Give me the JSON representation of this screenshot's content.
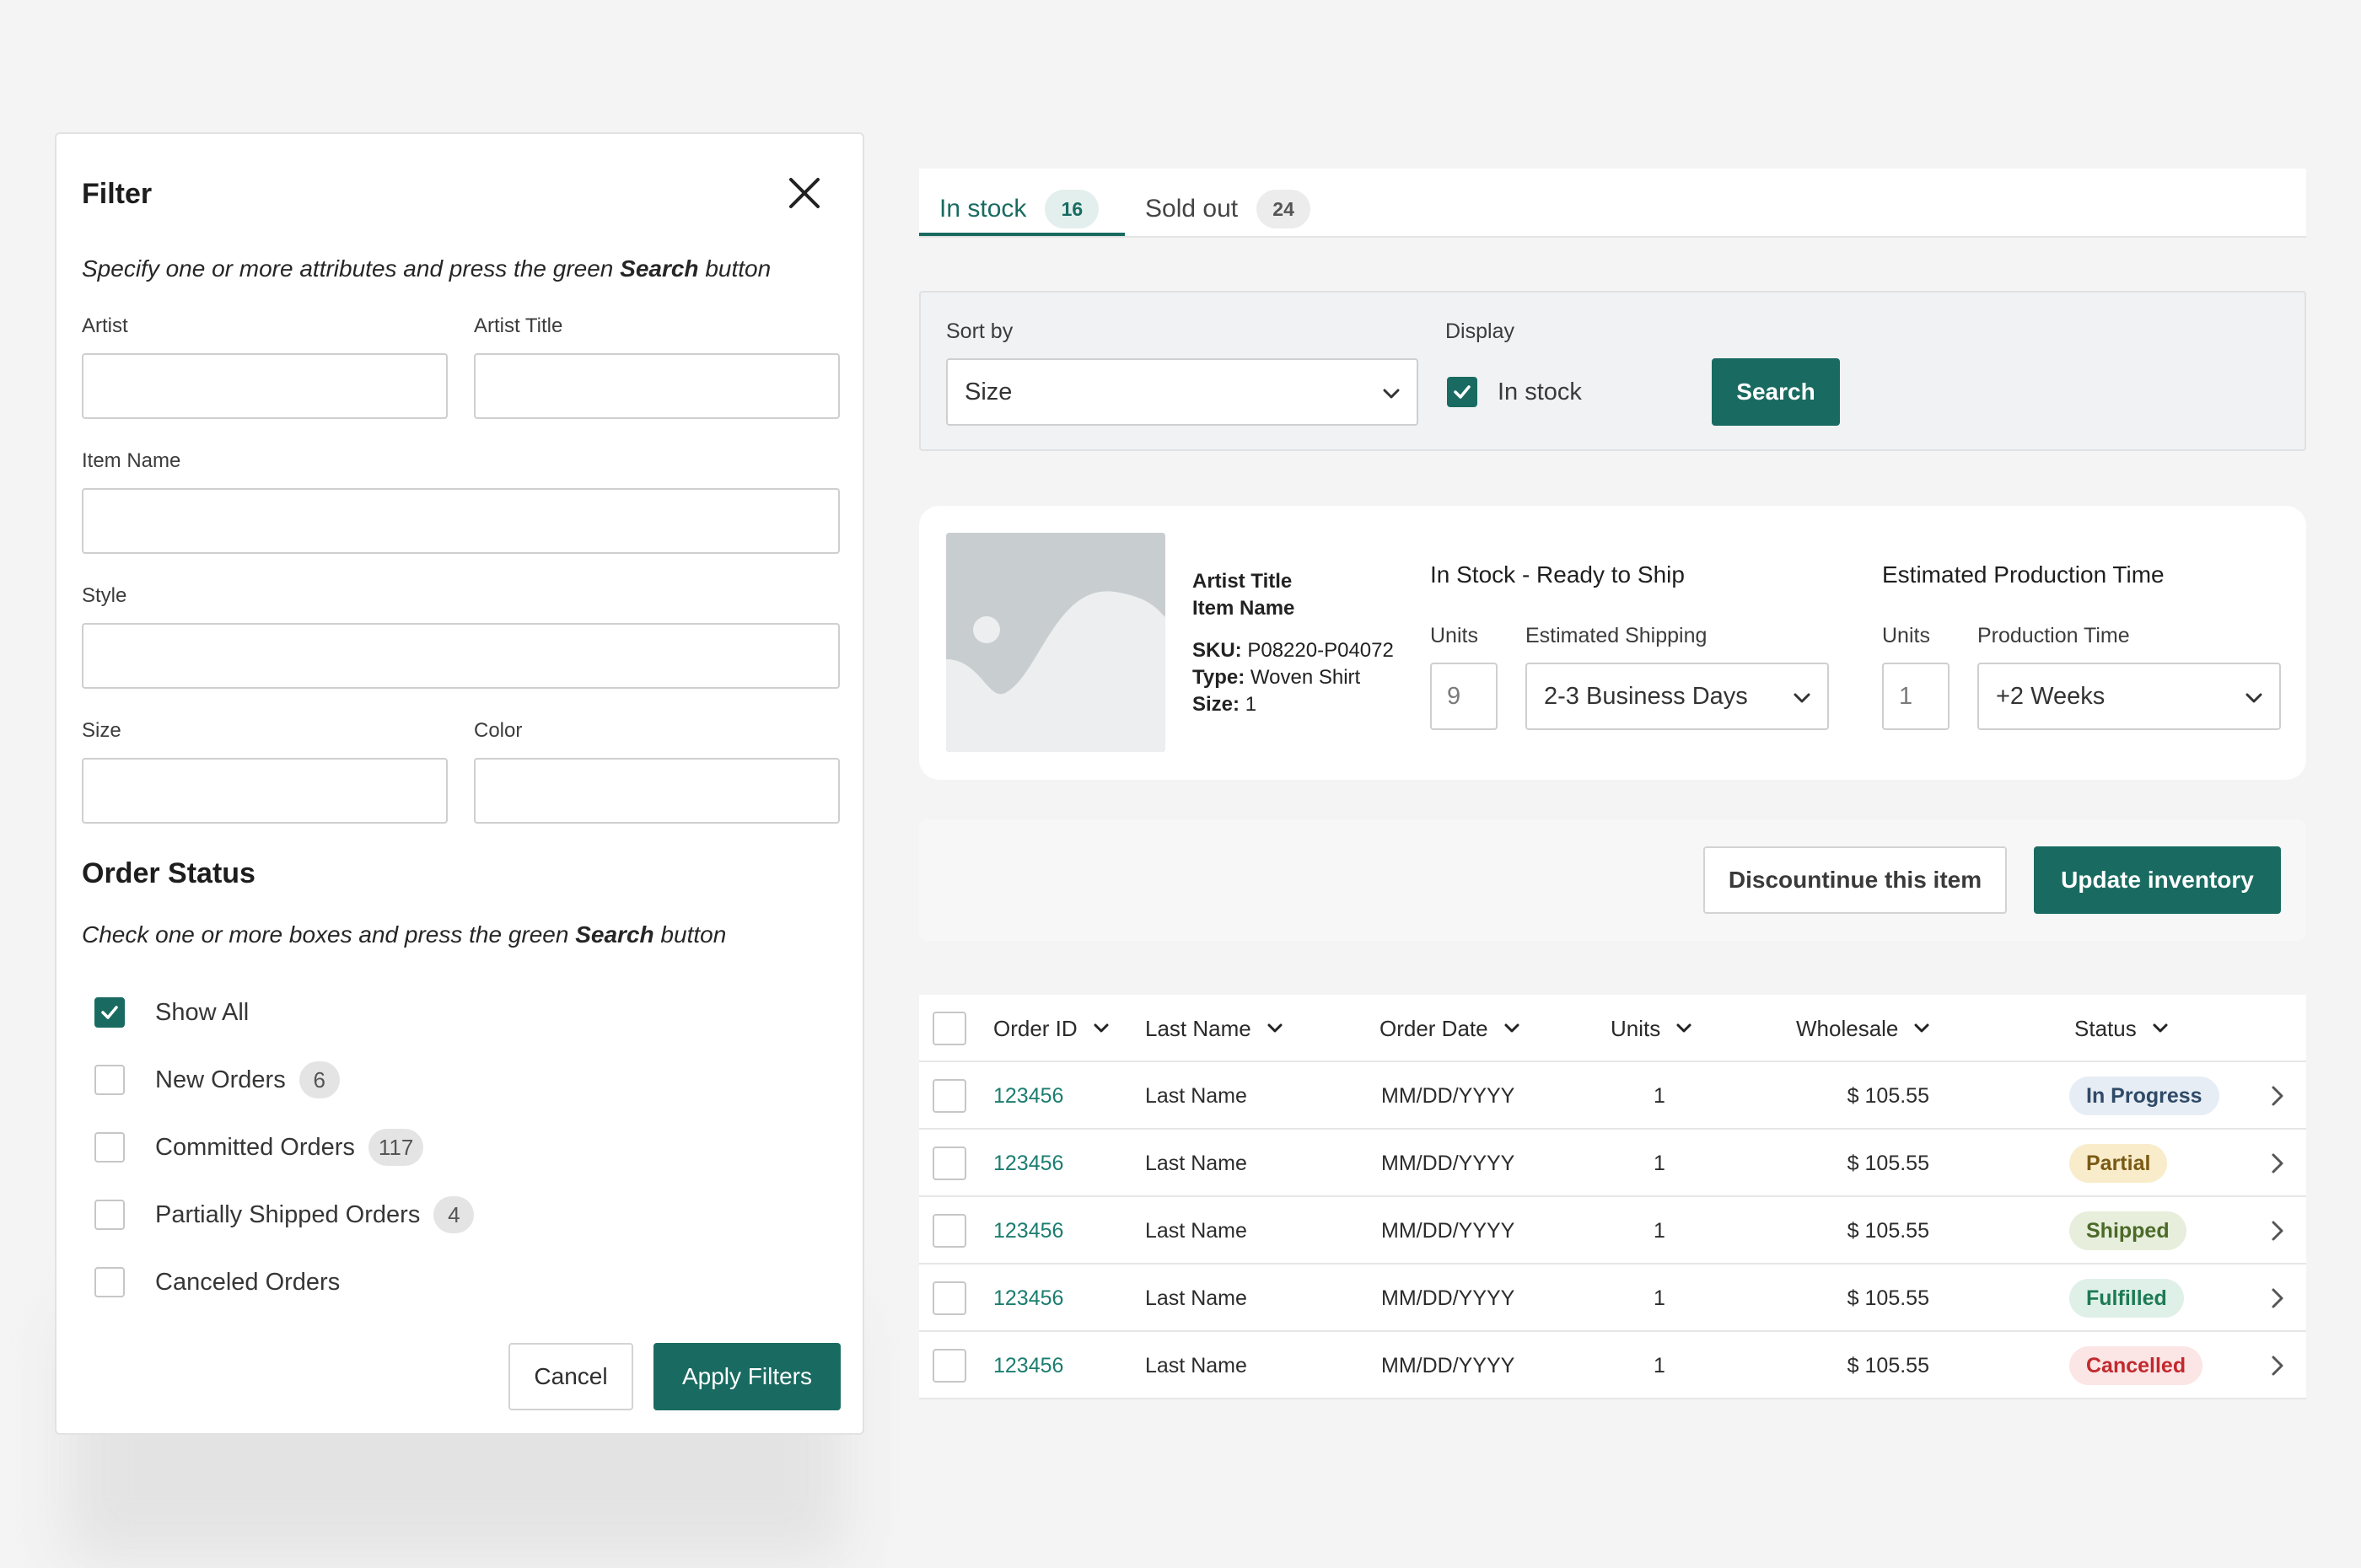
{
  "filter": {
    "title": "Filter",
    "help_pre": "Specify one or more attributes and press the green ",
    "help_bold": "Search",
    "help_post": " button",
    "fields": {
      "artist": "Artist",
      "artist_title": "Artist Title",
      "item_name": "Item Name",
      "style": "Style",
      "size": "Size",
      "color": "Color"
    },
    "order_status": {
      "title": "Order Status",
      "help_pre": "Check one or more boxes and press the green ",
      "help_bold": "Search",
      "help_post": " button",
      "options": [
        {
          "label": "Show All",
          "checked": true,
          "count": ""
        },
        {
          "label": "New Orders",
          "checked": false,
          "count": "6"
        },
        {
          "label": "Committed Orders",
          "checked": false,
          "count": "117"
        },
        {
          "label": "Partially Shipped Orders",
          "checked": false,
          "count": "4"
        },
        {
          "label": "Canceled Orders",
          "checked": false,
          "count": ""
        }
      ]
    },
    "cancel_label": "Cancel",
    "apply_label": "Apply Filters"
  },
  "tabs": [
    {
      "label": "In stock",
      "count": "16",
      "active": true
    },
    {
      "label": "Sold out",
      "count": "24",
      "active": false
    }
  ],
  "sort": {
    "sort_label": "Sort by",
    "sort_value": "Size",
    "display_label": "Display",
    "display_option": "In stock",
    "display_checked": true,
    "search_label": "Search"
  },
  "product": {
    "artist_title": "Artist Title",
    "item_name": "Item Name",
    "sku_label": "SKU:",
    "sku": "P08220-P04072",
    "type_label": "Type:",
    "type": "Woven Shirt",
    "size_label": "Size:",
    "size": "1",
    "in_stock": {
      "title": "In Stock - Ready to Ship",
      "units_label": "Units",
      "units": "9",
      "shipping_label": "Estimated Shipping",
      "shipping": "2-3 Business Days"
    },
    "production": {
      "title": "Estimated Production Time",
      "units_label": "Units",
      "units": "1",
      "time_label": "Production Time",
      "time": "+2 Weeks"
    }
  },
  "actions": {
    "discontinue_label": "Discountinue this item",
    "update_label": "Update inventory"
  },
  "table": {
    "columns": [
      "Order ID",
      "Last Name",
      "Order Date",
      "Units",
      "Wholesale",
      "Status"
    ],
    "rows": [
      {
        "order_id": "123456",
        "last_name": "Last Name",
        "date": "MM/DD/YYYY",
        "units": "1",
        "wholesale": "$ 105.55",
        "status": "In Progress"
      },
      {
        "order_id": "123456",
        "last_name": "Last Name",
        "date": "MM/DD/YYYY",
        "units": "1",
        "wholesale": "$ 105.55",
        "status": "Partial"
      },
      {
        "order_id": "123456",
        "last_name": "Last Name",
        "date": "MM/DD/YYYY",
        "units": "1",
        "wholesale": "$ 105.55",
        "status": "Shipped"
      },
      {
        "order_id": "123456",
        "last_name": "Last Name",
        "date": "MM/DD/YYYY",
        "units": "1",
        "wholesale": "$ 105.55",
        "status": "Fulfilled"
      },
      {
        "order_id": "123456",
        "last_name": "Last Name",
        "date": "MM/DD/YYYY",
        "units": "1",
        "wholesale": "$ 105.55",
        "status": "Cancelled"
      }
    ],
    "status_colors": {
      "In Progress": {
        "bg": "#e6edf5",
        "fg": "#2f4a66"
      },
      "Partial": {
        "bg": "#f8eccb",
        "fg": "#7a5a14"
      },
      "Shipped": {
        "bg": "#e7eedb",
        "fg": "#4b6a28"
      },
      "Fulfilled": {
        "bg": "#dff0e8",
        "fg": "#1d7a55"
      },
      "Cancelled": {
        "bg": "#fbe5e5",
        "fg": "#c2292e"
      }
    }
  },
  "colors": {
    "accent": "#196b61",
    "link": "#1b7d6f"
  }
}
